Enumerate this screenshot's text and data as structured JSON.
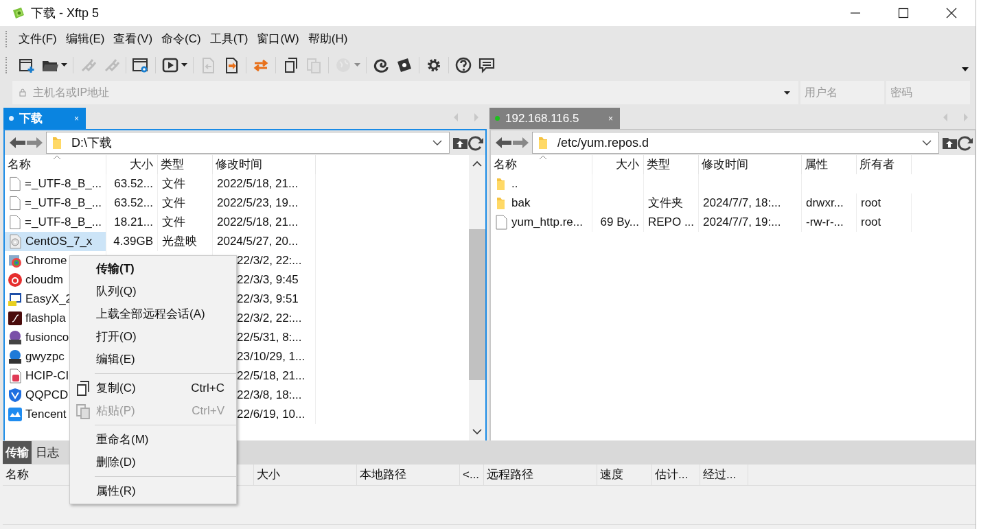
{
  "window": {
    "title": "下载 - Xftp 5"
  },
  "menu": [
    "文件(F)",
    "编辑(E)",
    "查看(V)",
    "命令(C)",
    "工具(T)",
    "窗口(W)",
    "帮助(H)"
  ],
  "toolbar": [
    {
      "kind": "new-session",
      "disabled": false,
      "caret": false,
      "separator": false
    },
    {
      "kind": "open-folder",
      "disabled": false,
      "caret": true,
      "separator": true
    },
    {
      "kind": "plug",
      "disabled": true,
      "caret": false,
      "separator": false
    },
    {
      "kind": "unplug",
      "disabled": true,
      "caret": false,
      "separator": true
    },
    {
      "kind": "properties",
      "disabled": false,
      "caret": false,
      "separator": true
    },
    {
      "kind": "play",
      "disabled": false,
      "caret": true,
      "separator": true
    },
    {
      "kind": "download",
      "disabled": true,
      "caret": false,
      "separator": false
    },
    {
      "kind": "upload",
      "disabled": false,
      "caret": false,
      "separator": true
    },
    {
      "kind": "sync",
      "disabled": false,
      "caret": false,
      "separator": true
    },
    {
      "kind": "copy",
      "disabled": false,
      "caret": false,
      "separator": false
    },
    {
      "kind": "paste",
      "disabled": true,
      "caret": false,
      "separator": true
    },
    {
      "kind": "globe",
      "disabled": true,
      "caret": true,
      "separator": true
    },
    {
      "kind": "shell",
      "disabled": false,
      "caret": false,
      "separator": false
    },
    {
      "kind": "logo",
      "disabled": false,
      "caret": false,
      "separator": true
    },
    {
      "kind": "gear",
      "disabled": false,
      "caret": false,
      "separator": true
    },
    {
      "kind": "help",
      "disabled": false,
      "caret": false,
      "separator": false
    },
    {
      "kind": "chat",
      "disabled": false,
      "caret": false,
      "separator": false
    }
  ],
  "address_bar": {
    "host_placeholder": "主机名或IP地址",
    "user_placeholder": "用户名",
    "password_placeholder": "密码"
  },
  "panels": [
    {
      "tab": {
        "label": "下载",
        "selected": true,
        "close": "×"
      },
      "path": "D:\\下载",
      "columns": [
        "名称",
        "大小",
        "类型",
        "修改时间"
      ],
      "rows": [
        {
          "kind": "doc",
          "name": "=_UTF-8_B_...",
          "size": "63.52...",
          "type": "文件",
          "modified": "2022/5/18, 21...",
          "selected": false
        },
        {
          "kind": "doc",
          "name": "=_UTF-8_B_...",
          "size": "63.52...",
          "type": "文件",
          "modified": "2022/5/23, 19...",
          "selected": false
        },
        {
          "kind": "doc",
          "name": "=_UTF-8_B_...",
          "size": "18.21...",
          "type": "文件",
          "modified": "2022/5/18, 21...",
          "selected": false
        },
        {
          "kind": "disc",
          "name": "CentOS_7_x",
          "size": "4.39GB",
          "type": "光盘映",
          "modified": "2024/5/27, 20...",
          "selected": true
        },
        {
          "kind": "setup",
          "name": "Chrome",
          "modified": "22/3/2, 22:...",
          "selected": false
        },
        {
          "kind": "music",
          "name": "cloudm",
          "modified": "22/3/3, 9:45",
          "selected": false
        },
        {
          "kind": "easyx",
          "name": "EasyX_2",
          "modified": "22/3/3, 9:51",
          "selected": false
        },
        {
          "kind": "flash",
          "name": "flashpla",
          "modified": "22/3/2, 22:...",
          "selected": false
        },
        {
          "kind": "rar",
          "name": "fusionco",
          "modified": "22/5/31, 8:...",
          "selected": false
        },
        {
          "kind": "zip",
          "name": "gwyzpc",
          "modified": "23/10/29, 1...",
          "selected": false
        },
        {
          "kind": "pdf",
          "name": "HCIP-CI",
          "modified": "22/5/18, 21...",
          "selected": false
        },
        {
          "kind": "shield",
          "name": "QQPCD",
          "modified": "22/3/8, 18:...",
          "selected": false
        },
        {
          "kind": "cloud",
          "name": "Tencent",
          "modified": "22/6/19, 10...",
          "selected": false
        }
      ]
    },
    {
      "tab": {
        "label": "192.168.116.5",
        "selected": false,
        "close": "×"
      },
      "path": "/etc/yum.repos.d",
      "columns": [
        "名称",
        "大小",
        "类型",
        "修改时间",
        "属性",
        "所有者"
      ],
      "rows": [
        {
          "kind": "folder",
          "name": "..",
          "selected": false
        },
        {
          "kind": "folder",
          "name": "bak",
          "type": "文件夹",
          "modified": "2024/7/7, 18:...",
          "attributes": "drwxr...",
          "owner": "root",
          "selected": false
        },
        {
          "kind": "doc",
          "name": "yum_http.re...",
          "size": "69 By...",
          "type": "REPO ...",
          "modified": "2024/7/7, 19:...",
          "attributes": "-rw-r-...",
          "owner": "root",
          "selected": false
        }
      ]
    }
  ],
  "context_menu": [
    [
      {
        "kind": "plain",
        "label": "传输(T)",
        "default": true,
        "disabled": false
      },
      {
        "kind": "plain",
        "label": "队列(Q)",
        "default": false,
        "disabled": false
      },
      {
        "kind": "plain",
        "label": "上载全部远程会话(A)",
        "default": false,
        "disabled": false
      },
      {
        "kind": "plain",
        "label": "打开(O)",
        "default": false,
        "disabled": false
      },
      {
        "kind": "plain",
        "label": "编辑(E)",
        "default": false,
        "disabled": false
      }
    ],
    [
      {
        "kind": "copy",
        "label": "复制(C)",
        "shortcut": "Ctrl+C",
        "default": false,
        "disabled": false
      },
      {
        "kind": "paste",
        "label": "粘贴(P)",
        "shortcut": "Ctrl+V",
        "default": false,
        "disabled": true
      }
    ],
    [
      {
        "kind": "plain",
        "label": "重命名(M)",
        "default": false,
        "disabled": false
      },
      {
        "kind": "plain",
        "label": "删除(D)",
        "default": false,
        "disabled": false
      }
    ],
    [
      {
        "kind": "plain",
        "label": "属性(R)",
        "default": false,
        "disabled": false
      }
    ]
  ],
  "transfer_pane": {
    "tabs": [
      {
        "label": "传输",
        "selected": true
      },
      {
        "label": "日志",
        "selected": false
      }
    ],
    "columns": [
      "名称",
      "大小",
      "本地路径",
      "<...",
      "远程路径",
      "速度",
      "估计...",
      "经过..."
    ]
  }
}
